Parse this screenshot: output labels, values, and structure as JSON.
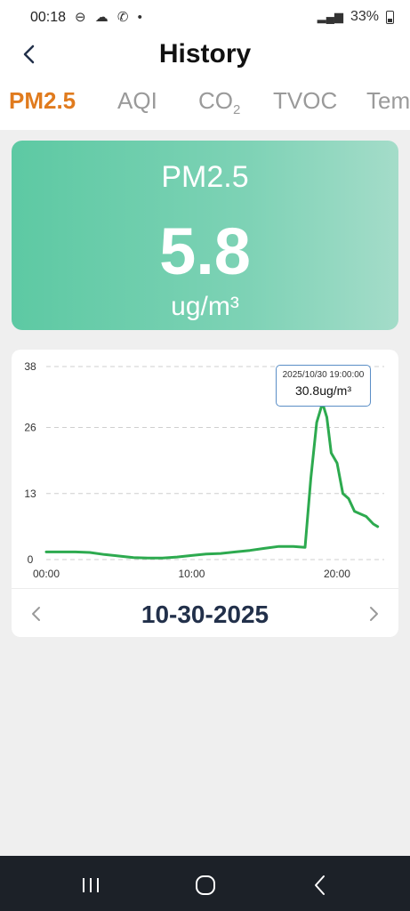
{
  "status_bar": {
    "time": "00:18",
    "battery": "33%"
  },
  "header": {
    "title": "History"
  },
  "tabs": [
    {
      "label": "PM2.5",
      "active": true
    },
    {
      "label": "AQI",
      "active": false
    },
    {
      "label": "CO",
      "sub": "2",
      "active": false
    },
    {
      "label": "TVOC",
      "active": false
    },
    {
      "label": "Tem",
      "active": false
    }
  ],
  "reading": {
    "label": "PM2.5",
    "value": "5.8",
    "unit": "ug/m³"
  },
  "chart_data": {
    "type": "line",
    "x_tick_labels": [
      "00:00",
      "10:00",
      "20:00"
    ],
    "y_tick_labels": [
      "0",
      "13",
      "26",
      "38"
    ],
    "ylim": [
      0,
      38
    ],
    "xlim": [
      0,
      23
    ],
    "grid": true,
    "color": "#2daa4f",
    "series": [
      {
        "x": [
          0,
          1,
          2,
          3,
          4,
          5,
          6,
          7,
          8,
          9,
          10,
          11,
          12,
          13,
          14,
          15,
          16,
          17,
          17.8,
          18.2,
          18.6,
          19,
          19.3,
          19.6,
          20,
          20.4,
          20.8,
          21.2,
          21.6,
          22,
          22.5,
          22.8
        ],
        "y": [
          1.5,
          1.5,
          1.5,
          1.4,
          1.0,
          0.7,
          0.4,
          0.3,
          0.3,
          0.5,
          0.8,
          1.1,
          1.2,
          1.5,
          1.8,
          2.2,
          2.6,
          2.6,
          2.4,
          16,
          27,
          30.8,
          28,
          21,
          19,
          13,
          12,
          9.5,
          9,
          8.5,
          7,
          6.5
        ]
      }
    ],
    "tooltip": {
      "time": "2025/10/30 19:00:00",
      "value": "30.8ug/m³"
    }
  },
  "date_nav": {
    "date": "10-30-2025"
  },
  "colors": {
    "accent": "#e07b1e",
    "card_green": "#5dc9a3",
    "line": "#2daa4f"
  }
}
